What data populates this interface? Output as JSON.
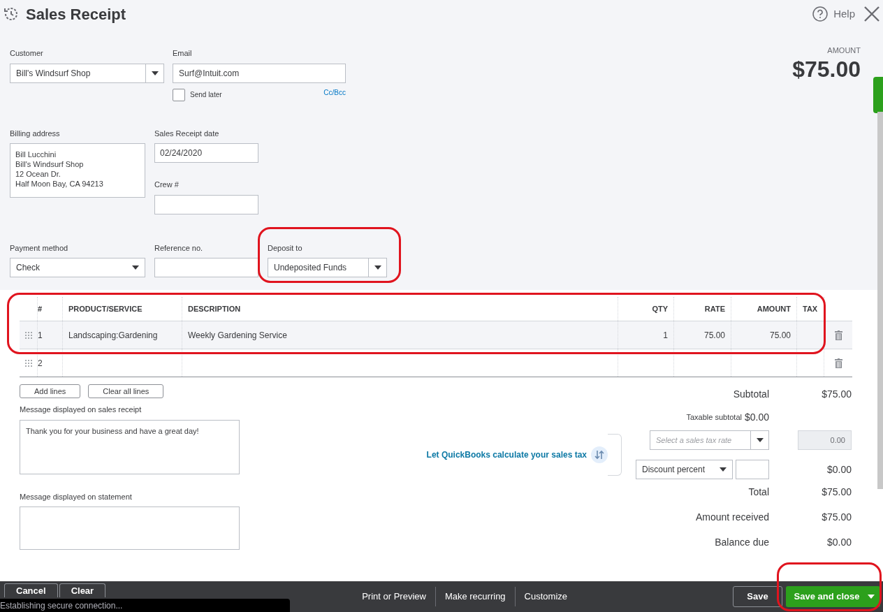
{
  "header": {
    "title": "Sales Receipt",
    "help": "Help"
  },
  "amount": {
    "label": "AMOUNT",
    "value": "$75.00"
  },
  "customer": {
    "label": "Customer",
    "value": "Bill's Windsurf Shop"
  },
  "email": {
    "label": "Email",
    "value": "Surf@Intuit.com",
    "send_later": {
      "label": "Send later",
      "checked": false
    },
    "cc_bcc": "Cc/Bcc"
  },
  "billing_address": {
    "label": "Billing address",
    "lines": [
      "Bill Lucchini",
      "Bill's Windsurf Shop",
      "12 Ocean Dr.",
      "Half Moon Bay, CA  94213"
    ]
  },
  "sales_receipt_date": {
    "label": "Sales Receipt date",
    "value": "02/24/2020"
  },
  "crew": {
    "label": "Crew #"
  },
  "payment_method": {
    "label": "Payment method",
    "value": "Check"
  },
  "reference_no": {
    "label": "Reference no."
  },
  "deposit_to": {
    "label": "Deposit to",
    "value": "Undeposited Funds",
    "highlighted": true
  },
  "lines_table": {
    "highlighted": true,
    "columns": [
      "#",
      "PRODUCT/SERVICE",
      "DESCRIPTION",
      "QTY",
      "RATE",
      "AMOUNT",
      "TAX"
    ],
    "rows": [
      {
        "number": "1",
        "product": "Landscaping:Gardening",
        "description": "Weekly Gardening Service",
        "qty": "1",
        "rate": "75.00",
        "amount": "75.00",
        "selected": true
      },
      {
        "number": "2",
        "selected": false
      }
    ]
  },
  "line_buttons": [
    "Add lines",
    "Clear all lines"
  ],
  "message_receipt": {
    "label": "Message displayed on sales receipt",
    "value": "Thank you for your business and have a great day!"
  },
  "message_statement": {
    "label": "Message displayed on statement"
  },
  "totals": {
    "subtotal": {
      "label": "Subtotal",
      "value": "$75.00"
    },
    "taxable_subtotal": {
      "label": "Taxable subtotal",
      "value": "$0.00"
    },
    "tax_link": "Let QuickBooks calculate your sales tax",
    "tax_rate": {
      "placeholder": "Select a sales tax rate"
    },
    "tax_amount": "0.00",
    "discount": {
      "value": "Discount percent",
      "amount": "$0.00"
    },
    "rows": [
      {
        "label": "Total",
        "value": "$75.00"
      },
      {
        "label": "Amount received",
        "value": "$75.00"
      },
      {
        "label": "Balance due",
        "value": "$0.00"
      }
    ]
  },
  "footer": {
    "left": [
      "Cancel",
      "Clear"
    ],
    "center": [
      "Print or Preview",
      "Make recurring",
      "Customize"
    ],
    "save": "Save",
    "save_and_close": {
      "label": "Save and close",
      "highlighted": true
    }
  },
  "status": "Establishing secure connection..."
}
